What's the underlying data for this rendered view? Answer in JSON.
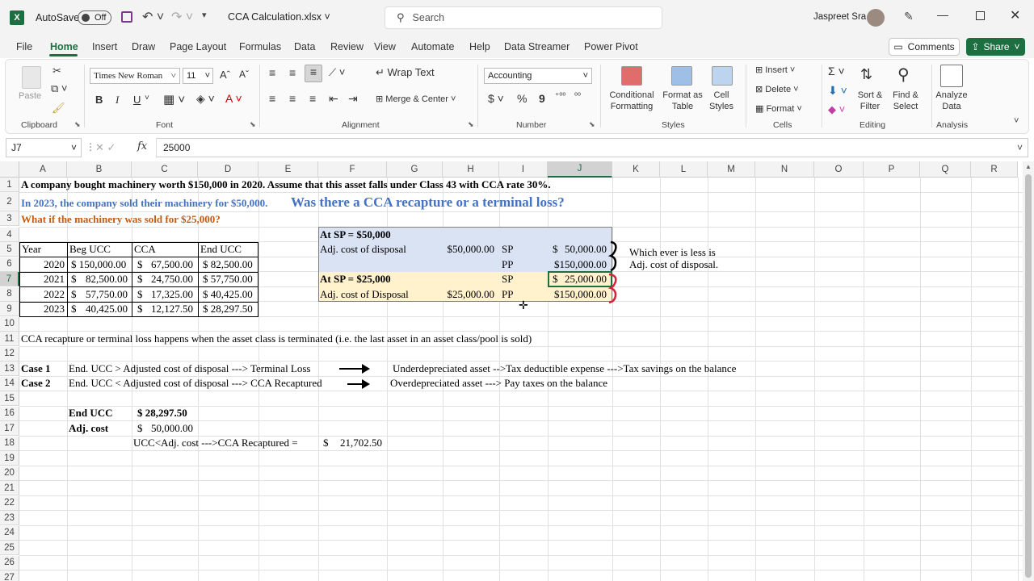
{
  "titlebar": {
    "autosave_label": "AutoSave",
    "autosave_state": "Off",
    "file_title": "CCA Calculation.xlsx",
    "search_placeholder": "Search",
    "user_name": "Jaspreet Sra"
  },
  "menu": {
    "tabs": [
      "File",
      "Home",
      "Insert",
      "Draw",
      "Page Layout",
      "Formulas",
      "Data",
      "Review",
      "View",
      "Automate",
      "Help",
      "Data Streamer",
      "Power Pivot"
    ],
    "active": "Home",
    "comments_label": "Comments",
    "share_label": "Share"
  },
  "ribbon": {
    "clipboard": {
      "paste": "Paste",
      "label": "Clipboard"
    },
    "font": {
      "name": "Times New Roman",
      "size": "11",
      "label": "Font",
      "bold": "B",
      "italic": "I",
      "underline": "U"
    },
    "alignment": {
      "wrap_text": "Wrap Text",
      "merge_center": "Merge & Center",
      "label": "Alignment"
    },
    "number": {
      "format": "Accounting",
      "label": "Number",
      "currency": "$",
      "percent": "%",
      "comma": "9"
    },
    "styles": {
      "conditional": "Conditional Formatting",
      "format_table": "Format as Table",
      "cell_styles": "Cell Styles",
      "label": "Styles"
    },
    "cells": {
      "insert": "Insert",
      "delete": "Delete",
      "format": "Format",
      "label": "Cells"
    },
    "editing": {
      "sort_filter": "Sort & Filter",
      "find_select": "Find & Select",
      "label": "Editing"
    },
    "analysis": {
      "analyze_data": "Analyze Data",
      "label": "Analysis"
    }
  },
  "formula_bar": {
    "name_box": "J7",
    "fx": "fx",
    "value": "25000"
  },
  "columns": [
    "A",
    "B",
    "C",
    "D",
    "E",
    "F",
    "G",
    "H",
    "I",
    "J",
    "K",
    "L",
    "M",
    "N",
    "O",
    "P",
    "Q",
    "R"
  ],
  "rows": [
    "1",
    "2",
    "3",
    "4",
    "5",
    "6",
    "7",
    "8",
    "9",
    "10",
    "11",
    "12",
    "13",
    "14",
    "15",
    "16",
    "17",
    "18",
    "19",
    "20",
    "21",
    "22",
    "23",
    "24",
    "25",
    "26",
    "27"
  ],
  "selected_cell": {
    "column": "J",
    "row": "7"
  },
  "sheet": {
    "r1": "A company bought machinery worth $150,000 in 2020. Assume that this asset falls under Class 43 with CCA rate 30%.",
    "r2a": "In 2023, the company sold their machinery for $50,000.",
    "r2b": "Was there a CCA recapture or a terminal loss?",
    "r3": "What if the machinery was sold for $25,000?",
    "ucc_table": {
      "headers": [
        "Year",
        "Beg UCC",
        "CCA",
        "End UCC"
      ],
      "rows": [
        [
          "2020",
          "$ 150,000.00",
          "$",
          "67,500.00",
          "$ 82,500.00"
        ],
        [
          "2021",
          "$",
          "82,500.00",
          "$",
          "24,750.00",
          "$ 57,750.00"
        ],
        [
          "2022",
          "$",
          "57,750.00",
          "$",
          "17,325.00",
          "$ 40,425.00"
        ],
        [
          "2023",
          "$",
          "40,425.00",
          "$",
          "12,127.50",
          "$ 28,297.50"
        ]
      ]
    },
    "sp_box": {
      "h1": "At SP = $50,000",
      "adj1_label": "Adj. cost of disposal",
      "adj1_value": "$50,000.00",
      "sp1_label": "SP",
      "sp1_cur": "$",
      "sp1_value": "50,000.00",
      "pp1_label": "PP",
      "pp1_value": "$150,000.00",
      "h2": "At SP = $25,000",
      "adj2_label": "Adj. cost of Disposal",
      "adj2_value": "$25,000.00",
      "sp2_label": "SP",
      "sp2_cur": "$",
      "sp2_value": "25,000.00",
      "pp2_label": "PP",
      "pp2_value": "$150,000.00"
    },
    "note1": "Which ever is less is",
    "note2": "Adj. cost of disposal.",
    "r11": "CCA recapture or terminal loss happens when the asset class is terminated (i.e. the last asset in an asset class/pool is sold)",
    "case1_label": "Case 1",
    "case1_text": "End. UCC > Adjusted cost of disposal ---> Terminal Loss",
    "case1_note": "Underdepreciated asset -->Tax deductible expense --->Tax savings on the balance",
    "case2_label": "Case 2",
    "case2_text": "End. UCC < Adjusted cost of disposal ---> CCA Recaptured",
    "case2_note": "Overdepreciated asset ---> Pay taxes on the balance",
    "end_ucc_label": "End UCC",
    "end_ucc_value": "$ 28,297.50",
    "adj_cost_label": "Adj. cost",
    "adj_cost_cur": "$",
    "adj_cost_value": "50,000.00",
    "r18_formula": "UCC<Adj. cost --->CCA Recaptured =",
    "r18_cur": "$",
    "r18_value": "21,702.50"
  }
}
